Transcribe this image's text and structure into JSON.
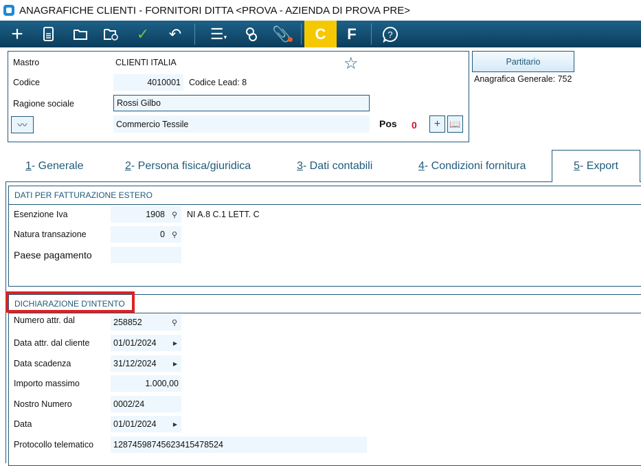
{
  "window": {
    "title": "ANAGRAFICHE CLIENTI - FORNITORI DITTA <PROVA - AZIENDA DI PROVA PRE>"
  },
  "toolbar": {
    "items": [
      "plus-icon",
      "document-icon",
      "folder-open-icon",
      "folder-clock-icon",
      "check-icon",
      "undo-icon",
      "menu-icon",
      "contacts-icon",
      "attachment-icon",
      "C",
      "F",
      "help-icon"
    ],
    "c_label": "C",
    "f_label": "F",
    "accent": "#f5c800"
  },
  "header": {
    "mastro_label": "Mastro",
    "mastro_value": "CLIENTI ITALIA",
    "codice_label": "Codice",
    "codice_value": "4010001",
    "codice_lead": "Codice Lead: 8",
    "ragione_label": "Ragione sociale",
    "ragione_value": "Rossi Gilbo",
    "categoria_value": "Commercio Tessile",
    "pos_label": "Pos",
    "pos_value": "0",
    "partitario_label": "Partitario",
    "anagrafica_generale": "Anagrafica Generale:  752"
  },
  "tabs": [
    {
      "num": "1",
      "label": " - Generale"
    },
    {
      "num": "2",
      "label": " - Persona fisica/giuridica"
    },
    {
      "num": "3",
      "label": " - Dati contabili"
    },
    {
      "num": "4",
      "label": " - Condizioni fornitura"
    },
    {
      "num": "5",
      "label": " - Export",
      "active": true
    }
  ],
  "fatturazione": {
    "title": "DATI PER FATTURAZIONE ESTERO",
    "esenzione_label": "Esenzione Iva",
    "esenzione_value": "1908",
    "esenzione_desc": "NI A.8 C.1 LETT. C",
    "natura_label": "Natura transazione",
    "natura_value": "0",
    "paese_label": "Paese pagamento",
    "paese_value": ""
  },
  "intento": {
    "title": "DICHIARAZIONE D'INTENTO",
    "rows": [
      {
        "label": "Numero attr. dal",
        "value": "258852"
      },
      {
        "label": "Data attr. dal cliente",
        "value": "01/01/2024"
      },
      {
        "label": "Data scadenza",
        "value": "31/12/2024"
      },
      {
        "label": "Importo massimo",
        "value": "1.000,00"
      },
      {
        "label": "Nostro Numero",
        "value": "0002/24"
      },
      {
        "label": "Data",
        "value": "01/01/2024"
      },
      {
        "label": "Protocollo telematico",
        "value": "12874598745623415478524"
      }
    ]
  }
}
